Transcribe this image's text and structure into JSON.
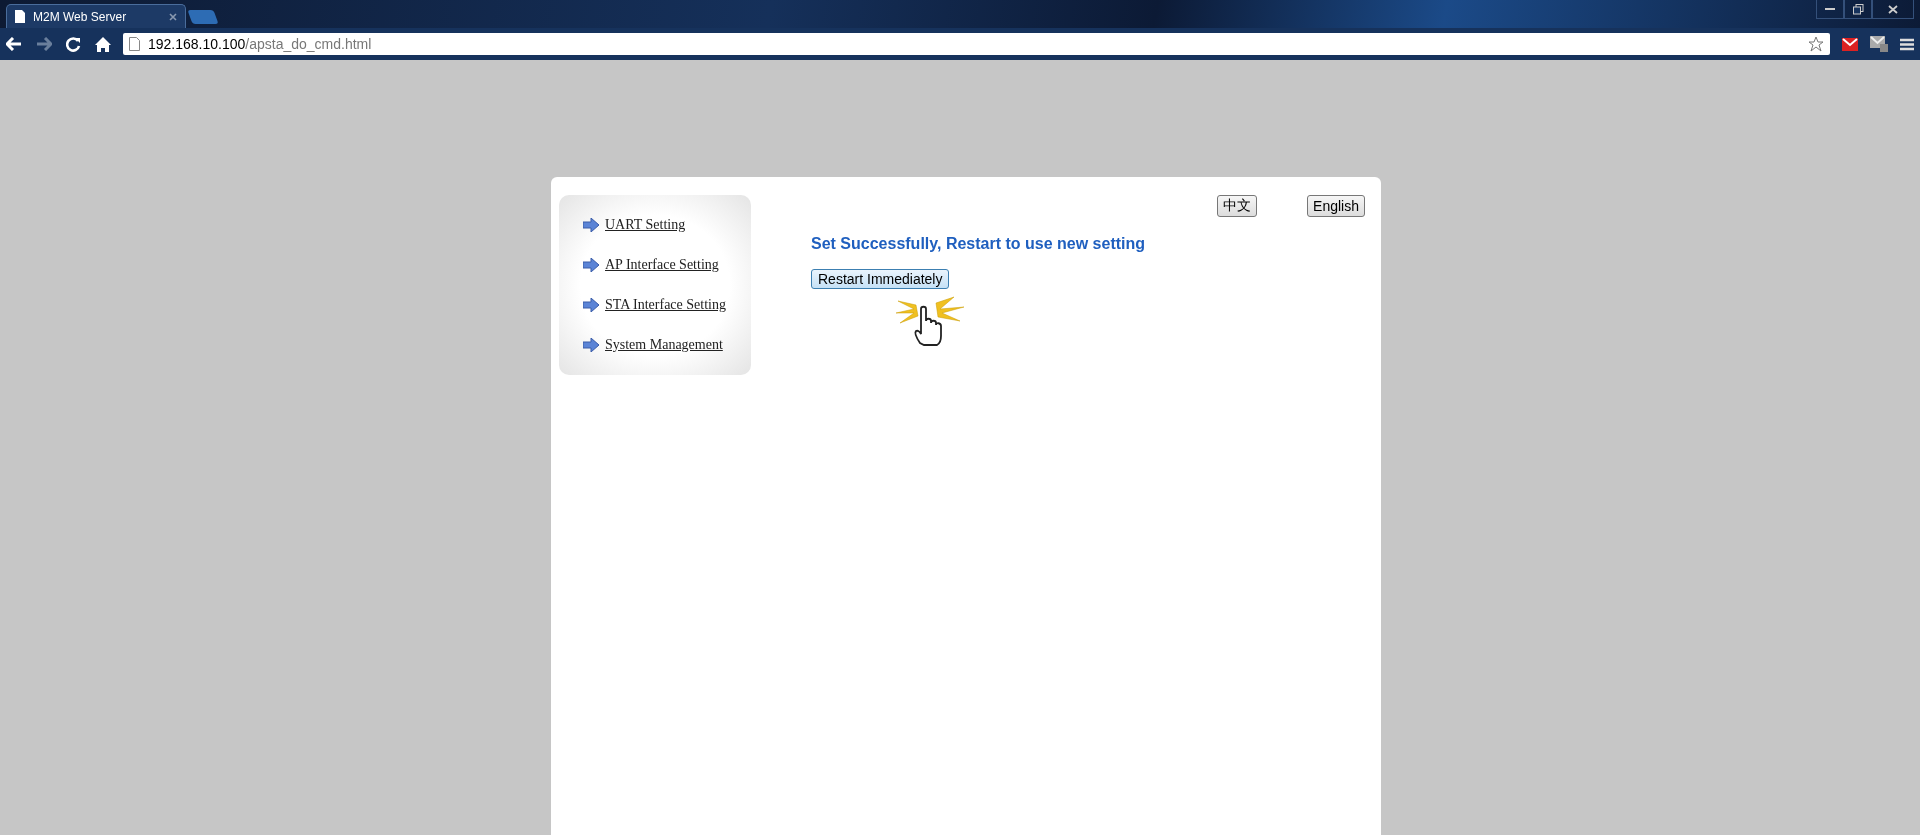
{
  "browser": {
    "tab_title": "M2M Web Server",
    "address": {
      "host": "192.168.10.100",
      "path": "/apsta_do_cmd.html"
    }
  },
  "page": {
    "language_buttons": [
      "中文",
      "English"
    ],
    "menu": [
      {
        "label": "UART Setting"
      },
      {
        "label": "AP Interface Setting"
      },
      {
        "label": "STA Interface Setting"
      },
      {
        "label": "System Management"
      }
    ],
    "message": "Set Successfully, Restart to use new setting",
    "restart_button": "Restart Immediately"
  }
}
